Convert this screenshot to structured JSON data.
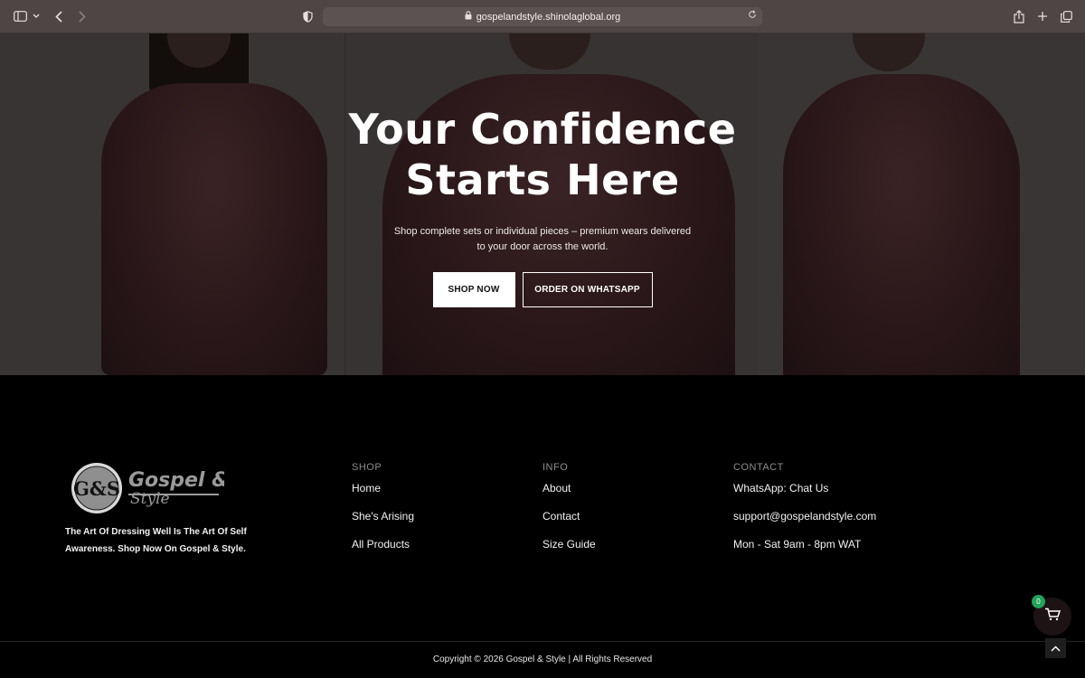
{
  "browser": {
    "url": "gospelandstyle.shinolaglobal.org"
  },
  "hero": {
    "title_line1": "Your Confidence",
    "title_line2": "Starts Here",
    "subtitle": "Shop complete sets or individual pieces – premium wears delivered to your door across the world.",
    "shop_button": "SHOP NOW",
    "whatsapp_button": "ORDER ON WHATSAPP"
  },
  "footer": {
    "logo_mark": "G&S",
    "logo_text_line1": "Gospel &",
    "logo_text_line2": "Style",
    "tagline": "The Art Of Dressing Well Is The Art Of Self Awareness. Shop Now On Gospel & Style.",
    "columns": [
      {
        "heading": "SHOP",
        "items": [
          "Home",
          "She's Arising",
          "All Products"
        ]
      },
      {
        "heading": "INFO",
        "items": [
          "About",
          "Contact",
          "Size Guide"
        ]
      },
      {
        "heading": "CONTACT",
        "items": [
          "WhatsApp: Chat Us",
          "support@gospelandstyle.com",
          "Mon - Sat 9am - 8pm WAT"
        ]
      }
    ],
    "copyright": "Copyright © 2026 Gospel & Style | All Rights Reserved"
  },
  "cart": {
    "count": "0"
  },
  "colors": {
    "badge": "#22a35a",
    "chrome": "#4e4644",
    "hero_overlay": "#353131"
  }
}
